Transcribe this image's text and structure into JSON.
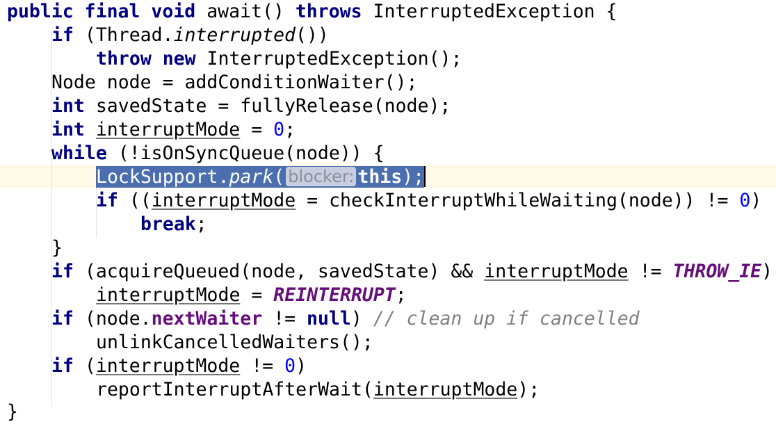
{
  "editor": {
    "lines": [
      {
        "l1_kw1": "public final void",
        "l1_name": " await() ",
        "l1_kw2": "throws",
        "l1_rest": " InterruptedException {"
      },
      {
        "l2_kw": "if",
        "l2_a": " (Thread.",
        "l2_it": "interrupted",
        "l2_b": "())"
      },
      {
        "l3_kw": "throw new",
        "l3_rest": " InterruptedException();"
      },
      {
        "l4_text": "Node node = addConditionWaiter();"
      },
      {
        "l5_kw": "int",
        "l5_rest": " savedState = fullyRelease(node);"
      },
      {
        "l6_kw": "int",
        "l6_sp": " ",
        "l6_var": "interruptMode",
        "l6_eq": " = ",
        "l6_num": "0",
        "l6_end": ";"
      },
      {
        "l7_kw": "while",
        "l7_rest": " (!isOnSyncQueue(node)) {"
      },
      {
        "l8_a": "LockSupport.",
        "l8_it": "park",
        "l8_b": "(",
        "l8_hint": "blocker:",
        "l8_kw": "this",
        "l8_end": ");"
      },
      {
        "l9_kw": "if",
        "l9_a": " ((",
        "l9_var": "interruptMode",
        "l9_b": " = checkInterruptWhileWaiting(node)) != ",
        "l9_num": "0",
        "l9_end": ")"
      },
      {
        "l10_kw": "break",
        "l10_end": ";"
      },
      {
        "l11_text": "}"
      },
      {
        "l12_kw": "if",
        "l12_a": " (acquireQueued(node, savedState) && ",
        "l12_var": "interruptMode",
        "l12_b": " != ",
        "l12_const": "THROW_IE",
        "l12_end": ")"
      },
      {
        "l13_var": "interruptMode",
        "l13_eq": " = ",
        "l13_const": "REINTERRUPT",
        "l13_end": ";"
      },
      {
        "l14_kw": "if",
        "l14_a": " (node.",
        "l14_field": "nextWaiter",
        "l14_b": " != ",
        "l14_null": "null",
        "l14_c": ") ",
        "l14_cmt": "// clean up if cancelled"
      },
      {
        "l15_text": "unlinkCancelledWaiters();"
      },
      {
        "l16_kw": "if",
        "l16_a": " (",
        "l16_var": "interruptMode",
        "l16_b": " != ",
        "l16_num": "0",
        "l16_end": ")"
      },
      {
        "l17_a": "reportInterruptAfterWait(",
        "l17_var": "interruptMode",
        "l17_end": ");"
      },
      {
        "l18_text": "}"
      }
    ]
  },
  "theme": {
    "keyword": "#000080",
    "number": "#0000ff",
    "constant": "#660e7a",
    "comment": "#808080",
    "selection": "#4b6eaf",
    "current_line": "#fefae7",
    "param_hint_bg": "#c7cee0"
  }
}
